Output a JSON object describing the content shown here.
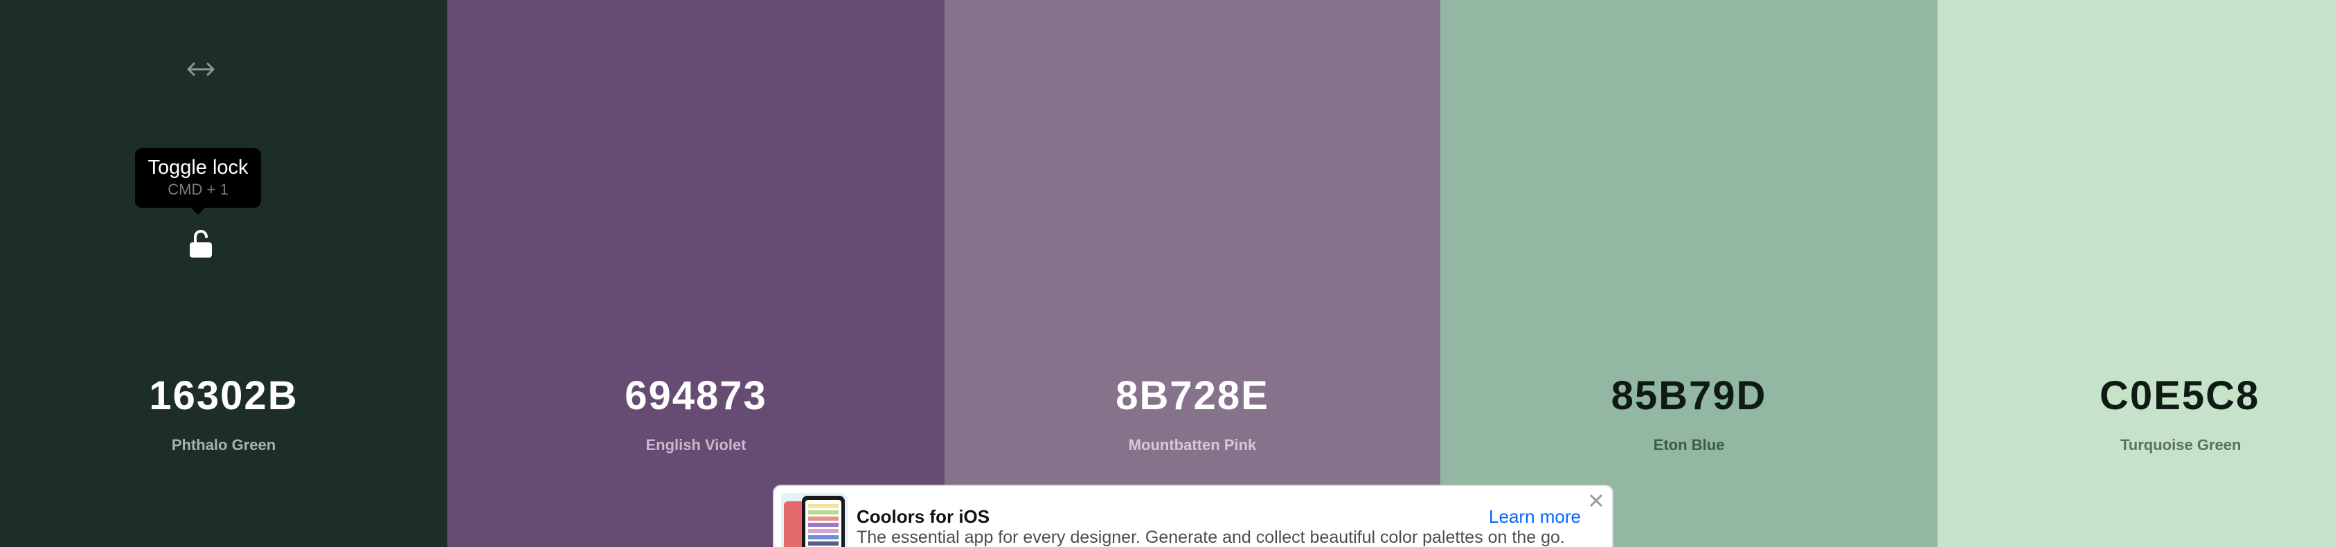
{
  "palette": {
    "colors": [
      {
        "hex": "16302B",
        "name": "Phthalo Green",
        "bg": "#16302B",
        "hex_color": "#ffffff",
        "name_color": "#a7b2ad"
      },
      {
        "hex": "694873",
        "name": "English Violet",
        "bg": "#694873",
        "hex_color": "#ffffff",
        "name_color": "#c8b8cc"
      },
      {
        "hex": "8B728E",
        "name": "Mountbatten Pink",
        "bg": "#8B728E",
        "hex_color": "#ffffff",
        "name_color": "#d3c9d5"
      },
      {
        "hex": "85B79D",
        "name": "Eton Blue",
        "bg": "#85B79D",
        "hex_color": "#0f1a14",
        "name_color": "#3e5a4b"
      },
      {
        "hex": "C0E5C8",
        "name": "Turquoise Green",
        "bg": "#C0E5C8",
        "hex_color": "#0f1a14",
        "name_color": "#5d7061"
      }
    ]
  },
  "controls": {
    "drag_icon": "arrows-horizontal-icon",
    "lock_icon": "unlocked-padlock-icon"
  },
  "tooltip": {
    "title": "Toggle lock",
    "shortcut": "CMD + 1"
  },
  "banner": {
    "title": "Coolors for iOS",
    "description": "The essential app for every designer. Generate and collect beautiful color palettes on the go.",
    "link": "Learn more",
    "close_icon": "close-icon",
    "link_color": "#0066ff"
  }
}
